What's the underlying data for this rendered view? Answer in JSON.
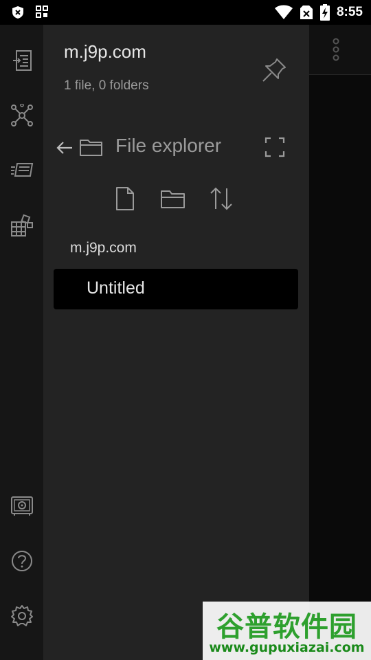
{
  "status_bar": {
    "time": "8:55",
    "left_icons": [
      "shield-x-icon",
      "apps-grid-icon"
    ],
    "right_icons": [
      "wifi-icon",
      "no-sim-icon",
      "battery-charging-icon"
    ]
  },
  "ribbon": {
    "top_icons": [
      "note-import-icon",
      "graph-view-icon",
      "slides-icon",
      "plugins-icon"
    ],
    "bottom_icons": [
      "vault-icon",
      "help-icon",
      "settings-icon"
    ]
  },
  "drawer": {
    "vault_name": "m.j9p.com",
    "vault_stats": "1 file, 0 folders",
    "explorer_title": "File explorer",
    "tree": {
      "root": "m.j9p.com",
      "files": [
        {
          "name": "Untitled"
        }
      ]
    }
  },
  "watermark": {
    "cn": "谷普软件园",
    "url": "www.gupuxiazai.com"
  },
  "colors": {
    "ribbon_bg": "#161616",
    "drawer_bg": "#232323",
    "active_file_bg": "#000000",
    "watermark_green": "#2ea02e"
  }
}
